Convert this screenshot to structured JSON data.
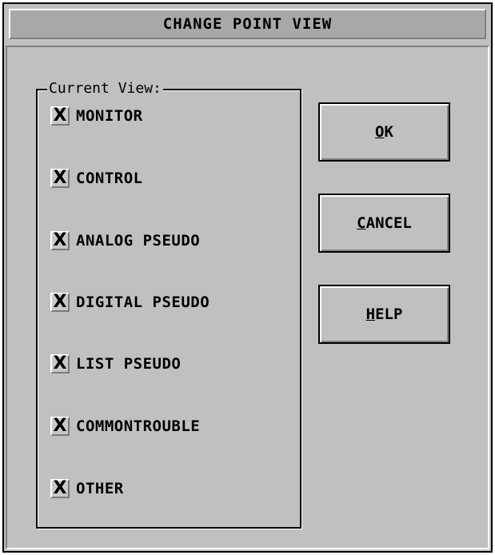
{
  "dialog": {
    "title": "CHANGE POINT VIEW"
  },
  "group": {
    "label": "Current View:",
    "items": [
      {
        "label": "MONITOR",
        "mark": "X",
        "checked": true
      },
      {
        "label": "CONTROL",
        "mark": "X",
        "checked": true
      },
      {
        "label": "ANALOG PSEUDO",
        "mark": "X",
        "checked": true
      },
      {
        "label": "DIGITAL PSEUDO",
        "mark": "X",
        "checked": true
      },
      {
        "label": "LIST PSEUDO",
        "mark": "X",
        "checked": true
      },
      {
        "label": "COMMONTROUBLE",
        "mark": "X",
        "checked": true
      },
      {
        "label": "OTHER",
        "mark": "X",
        "checked": true
      }
    ]
  },
  "buttons": {
    "ok": {
      "accel": "O",
      "rest": "K"
    },
    "cancel": {
      "accel": "C",
      "rest": "ANCEL"
    },
    "help": {
      "accel": "H",
      "rest": "ELP"
    }
  },
  "colors": {
    "face": "#c0c0c0",
    "title_bar": "#a8a8a8",
    "highlight": "#ffffff",
    "shadow": "#808080",
    "text": "#000000"
  }
}
